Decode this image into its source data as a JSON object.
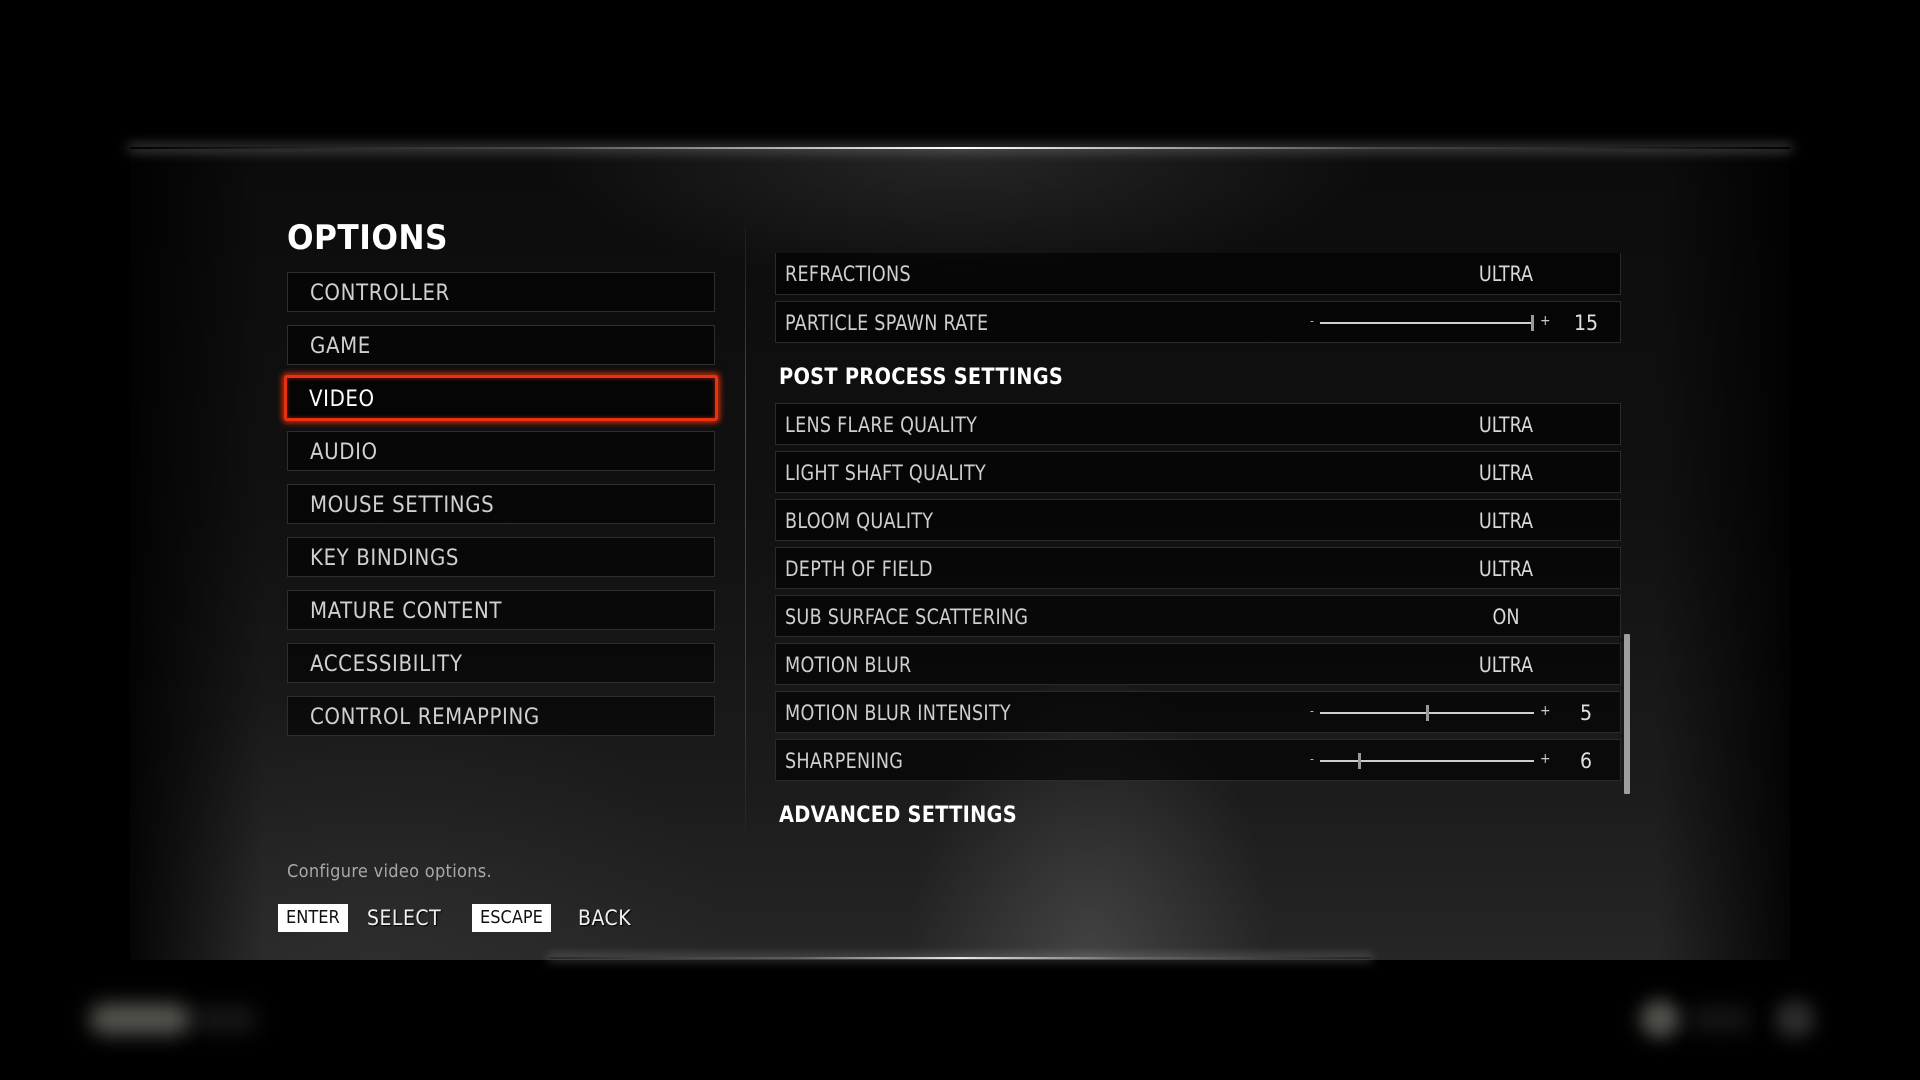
{
  "title": "OPTIONS",
  "menu": {
    "items": [
      {
        "label": "CONTROLLER"
      },
      {
        "label": "GAME"
      },
      {
        "label": "VIDEO",
        "active": true
      },
      {
        "label": "AUDIO"
      },
      {
        "label": "MOUSE SETTINGS"
      },
      {
        "label": "KEY BINDINGS"
      },
      {
        "label": "MATURE CONTENT"
      },
      {
        "label": "ACCESSIBILITY"
      },
      {
        "label": "CONTROL REMAPPING"
      }
    ]
  },
  "settings": {
    "top_rows": [
      {
        "label": "REFRACTIONS",
        "value": "ULTRA"
      },
      {
        "label": "PARTICLE SPAWN RATE",
        "slider_fraction": 1.0,
        "value": "15"
      }
    ],
    "post_process": {
      "header": "POST PROCESS SETTINGS",
      "rows": [
        {
          "label": "LENS FLARE QUALITY",
          "value": "ULTRA"
        },
        {
          "label": "LIGHT SHAFT QUALITY",
          "value": "ULTRA"
        },
        {
          "label": "BLOOM QUALITY",
          "value": "ULTRA"
        },
        {
          "label": "DEPTH OF FIELD",
          "value": "ULTRA"
        },
        {
          "label": "SUB SURFACE SCATTERING",
          "value": "ON"
        },
        {
          "label": "MOTION BLUR",
          "value": "ULTRA"
        },
        {
          "label": "MOTION BLUR INTENSITY",
          "slider_fraction": 0.5,
          "value": "5"
        },
        {
          "label": "SHARPENING",
          "slider_fraction": 0.18,
          "value": "6"
        }
      ]
    },
    "advanced_header": "ADVANCED SETTINGS",
    "slider_minus": "-",
    "slider_plus": "+"
  },
  "description": "Configure video options.",
  "prompts": [
    {
      "key": "ENTER",
      "action": "SELECT"
    },
    {
      "key": "ESCAPE",
      "action": "BACK"
    }
  ],
  "colors": {
    "accent": "#e8320f",
    "background": "#000000",
    "text": "#d0d0d0"
  }
}
